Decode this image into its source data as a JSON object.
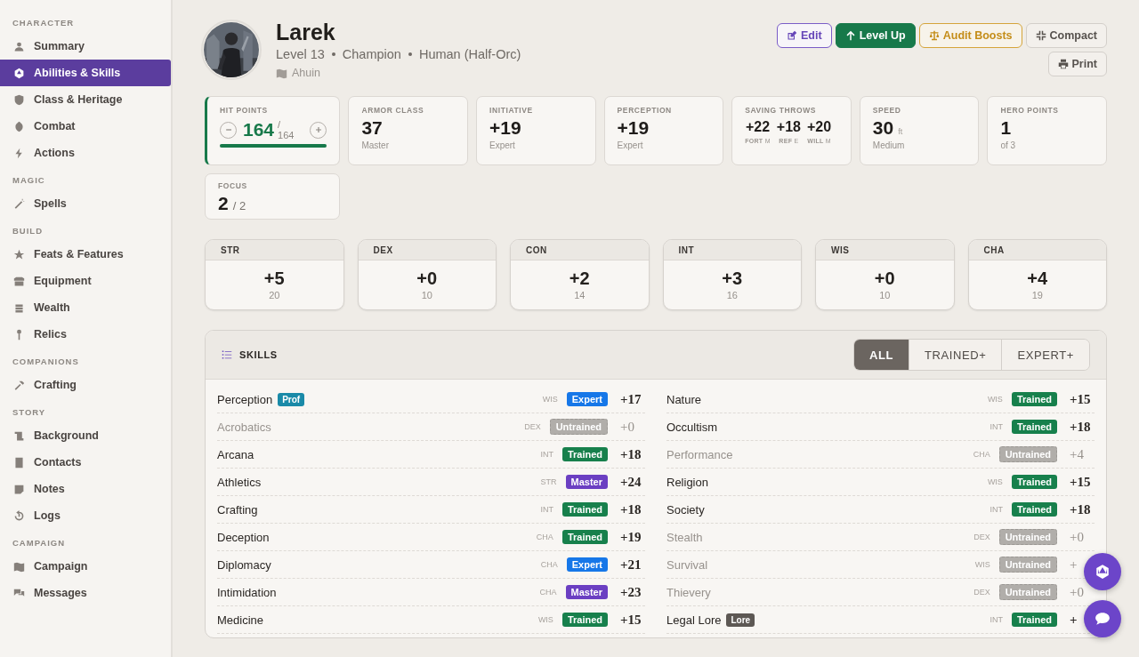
{
  "sidebar": [
    {
      "title": "CHARACTER",
      "items": [
        {
          "label": "Summary",
          "selected": false
        },
        {
          "label": "Abilities & Skills",
          "selected": true
        },
        {
          "label": "Class & Heritage",
          "selected": false
        },
        {
          "label": "Combat",
          "selected": false
        },
        {
          "label": "Actions",
          "selected": false
        }
      ]
    },
    {
      "title": "MAGIC",
      "items": [
        {
          "label": "Spells",
          "selected": false
        }
      ]
    },
    {
      "title": "BUILD",
      "items": [
        {
          "label": "Feats & Features",
          "selected": false
        },
        {
          "label": "Equipment",
          "selected": false
        },
        {
          "label": "Wealth",
          "selected": false
        },
        {
          "label": "Relics",
          "selected": false
        }
      ]
    },
    {
      "title": "COMPANIONS",
      "items": [
        {
          "label": "Crafting",
          "selected": false
        }
      ]
    },
    {
      "title": "STORY",
      "items": [
        {
          "label": "Background",
          "selected": false
        },
        {
          "label": "Contacts",
          "selected": false
        },
        {
          "label": "Notes",
          "selected": false
        },
        {
          "label": "Logs",
          "selected": false
        }
      ]
    },
    {
      "title": "CAMPAIGN",
      "items": [
        {
          "label": "Campaign",
          "selected": false
        },
        {
          "label": "Messages",
          "selected": false
        }
      ]
    }
  ],
  "character": {
    "name": "Larek",
    "details": [
      "Level 13",
      "Champion",
      "Human (Half-Orc)"
    ],
    "campaign": "Ahuin"
  },
  "actions": [
    {
      "label": "Edit",
      "kind": "outline-purple"
    },
    {
      "label": "Level Up",
      "kind": "primary"
    },
    {
      "label": "Audit Boosts",
      "kind": "outline-gold"
    },
    {
      "label": "Compact",
      "kind": "plain"
    },
    {
      "label": "Print",
      "kind": "plain"
    }
  ],
  "stats": [
    {
      "kind": "hp",
      "label": "HIT POINTS",
      "value": "164",
      "separator": "/",
      "max": "164",
      "level": 1
    },
    {
      "kind": "plain",
      "label": "ARMOR CLASS",
      "value": "37",
      "sub": "Master"
    },
    {
      "kind": "plain",
      "label": "INITIATIVE",
      "value": "+19",
      "sub": "Expert"
    },
    {
      "kind": "plain",
      "label": "PERCEPTION",
      "value": "+19",
      "sub": "Expert"
    },
    {
      "kind": "saves",
      "label": "SAVING THROWS",
      "saves": [
        {
          "value": "+22",
          "name": "FORT",
          "rank": "M"
        },
        {
          "value": "+18",
          "name": "REF",
          "rank": "E"
        },
        {
          "value": "+20",
          "name": "WILL",
          "rank": "M"
        }
      ]
    },
    {
      "kind": "plain",
      "label": "SPEED",
      "value": "30",
      "unit": "ft",
      "sub": "Medium"
    },
    {
      "kind": "plain",
      "label": "HERO POINTS",
      "value": "1",
      "sub": "of 3"
    },
    {
      "kind": "plain",
      "label": "FOCUS",
      "value": "2",
      "max": "/ 2"
    }
  ],
  "abilities": [
    {
      "name": "STR",
      "mod": "+5",
      "score": "20"
    },
    {
      "name": "DEX",
      "mod": "+0",
      "score": "10"
    },
    {
      "name": "CON",
      "mod": "+2",
      "score": "14"
    },
    {
      "name": "INT",
      "mod": "+3",
      "score": "16"
    },
    {
      "name": "WIS",
      "mod": "+0",
      "score": "10"
    },
    {
      "name": "CHA",
      "mod": "+4",
      "score": "19"
    }
  ],
  "skills": {
    "title": "SKILLS",
    "filters": [
      {
        "label": "ALL",
        "selected": true
      },
      {
        "label": "TRAINED+",
        "selected": false
      },
      {
        "label": "EXPERT+",
        "selected": false
      }
    ],
    "rows": [
      {
        "name": "Perception",
        "tag": {
          "text": "Prof",
          "kind": "prof"
        },
        "ability": "WIS",
        "rank": "Expert",
        "kind": "expert",
        "mod": "+17"
      },
      {
        "name": "Acrobatics",
        "ability": "DEX",
        "rank": "Untrained",
        "kind": "untrained",
        "mod": "+0"
      },
      {
        "name": "Arcana",
        "ability": "INT",
        "rank": "Trained",
        "kind": "trained",
        "mod": "+18"
      },
      {
        "name": "Athletics",
        "ability": "STR",
        "rank": "Master",
        "kind": "master",
        "mod": "+24"
      },
      {
        "name": "Crafting",
        "ability": "INT",
        "rank": "Trained",
        "kind": "trained",
        "mod": "+18"
      },
      {
        "name": "Deception",
        "ability": "CHA",
        "rank": "Trained",
        "kind": "trained",
        "mod": "+19"
      },
      {
        "name": "Diplomacy",
        "ability": "CHA",
        "rank": "Expert",
        "kind": "expert",
        "mod": "+21"
      },
      {
        "name": "Intimidation",
        "ability": "CHA",
        "rank": "Master",
        "kind": "master",
        "mod": "+23"
      },
      {
        "name": "Medicine",
        "ability": "WIS",
        "rank": "Trained",
        "kind": "trained",
        "mod": "+15"
      },
      {
        "name": "Nature",
        "ability": "WIS",
        "rank": "Trained",
        "kind": "trained",
        "mod": "+15"
      },
      {
        "name": "Occultism",
        "ability": "INT",
        "rank": "Trained",
        "kind": "trained",
        "mod": "+18"
      },
      {
        "name": "Performance",
        "ability": "CHA",
        "rank": "Untrained",
        "kind": "untrained",
        "mod": "+4"
      },
      {
        "name": "Religion",
        "ability": "WIS",
        "rank": "Trained",
        "kind": "trained",
        "mod": "+15"
      },
      {
        "name": "Society",
        "ability": "INT",
        "rank": "Trained",
        "kind": "trained",
        "mod": "+18"
      },
      {
        "name": "Stealth",
        "ability": "DEX",
        "rank": "Untrained",
        "kind": "untrained",
        "mod": "+0"
      },
      {
        "name": "Survival",
        "ability": "WIS",
        "rank": "Untrained",
        "kind": "untrained",
        "mod": "+"
      },
      {
        "name": "Thievery",
        "ability": "DEX",
        "rank": "Untrained",
        "kind": "untrained",
        "mod": "+0"
      },
      {
        "name": "Legal Lore",
        "tag": {
          "text": "Lore",
          "kind": "lore"
        },
        "ability": "INT",
        "rank": "Trained",
        "kind": "trained",
        "mod": "+"
      }
    ]
  }
}
